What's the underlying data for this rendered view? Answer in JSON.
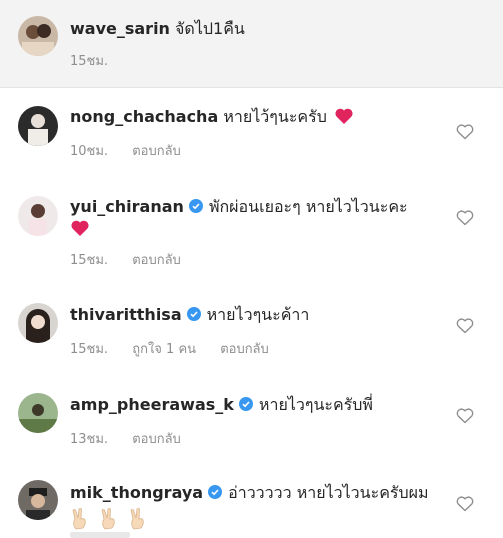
{
  "comments": [
    {
      "username": "wave_sarin",
      "verified": false,
      "text": "จัดไป1คืน",
      "time": "15ชม.",
      "likes": "",
      "reply": ""
    },
    {
      "username": "nong_chachacha",
      "verified": false,
      "text": "หายไว้ๆนะครับ",
      "time": "10ชม.",
      "likes": "",
      "reply": "ตอบกลับ"
    },
    {
      "username": "yui_chiranan",
      "verified": true,
      "text": "พักผ่อนเยอะๆ หายไวไวนะคะ",
      "time": "15ชม.",
      "likes": "",
      "reply": "ตอบกลับ"
    },
    {
      "username": "thivaritthisa",
      "verified": true,
      "text": "หายไวๆนะค้าา",
      "time": "15ชม.",
      "likes": "ถูกใจ 1 คน",
      "reply": "ตอบกลับ"
    },
    {
      "username": "amp_pheerawas_k",
      "verified": true,
      "text": "หายไวๆนะครับพี่",
      "time": "13ชม.",
      "likes": "",
      "reply": "ตอบกลับ"
    },
    {
      "username": "mik_thongraya",
      "verified": true,
      "text": "อ่าววววว หายไวไวนะครับผม",
      "time": "",
      "likes": "",
      "reply": ""
    }
  ],
  "colors": {
    "verified_badge": "#3897f0",
    "heart_emoji": "#e0245e",
    "meta_text": "#8e8e8e"
  },
  "icons": {
    "like": "heart-outline-icon",
    "verified": "verified-badge-icon",
    "heart_emoji": "red-heart-emoji",
    "peace_emoji": "victory-hand-emoji"
  }
}
